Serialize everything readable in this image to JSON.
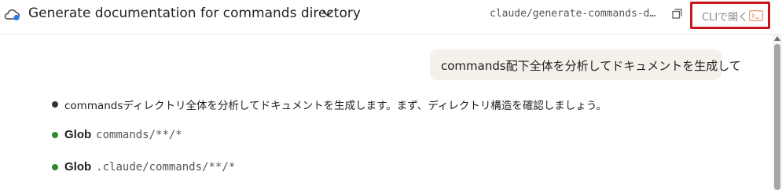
{
  "header": {
    "title": "Generate documentation for commands directory",
    "branch": "claude/generate-commands-d…",
    "open_cli_label": "CLIで開く"
  },
  "conversation": {
    "user_message": "commands配下全体を分析してドキュメントを生成して",
    "assistant_text": "commandsディレクトリ全体を分析してドキュメントを生成します。まず、ディレクトリ構造を確認しましょう。",
    "tool_calls": [
      {
        "tool": "Glob",
        "arg": "commands/**/*"
      },
      {
        "tool": "Glob",
        "arg": ".claude/commands/**/*"
      }
    ]
  },
  "colors": {
    "accent_highlight": "#c8161d",
    "bullet_success": "#2f8a2a",
    "user_bubble": "#f3f1ea"
  },
  "icons": [
    "cloud-icon",
    "chevron-down-icon",
    "copy-icon",
    "terminal-icon"
  ]
}
